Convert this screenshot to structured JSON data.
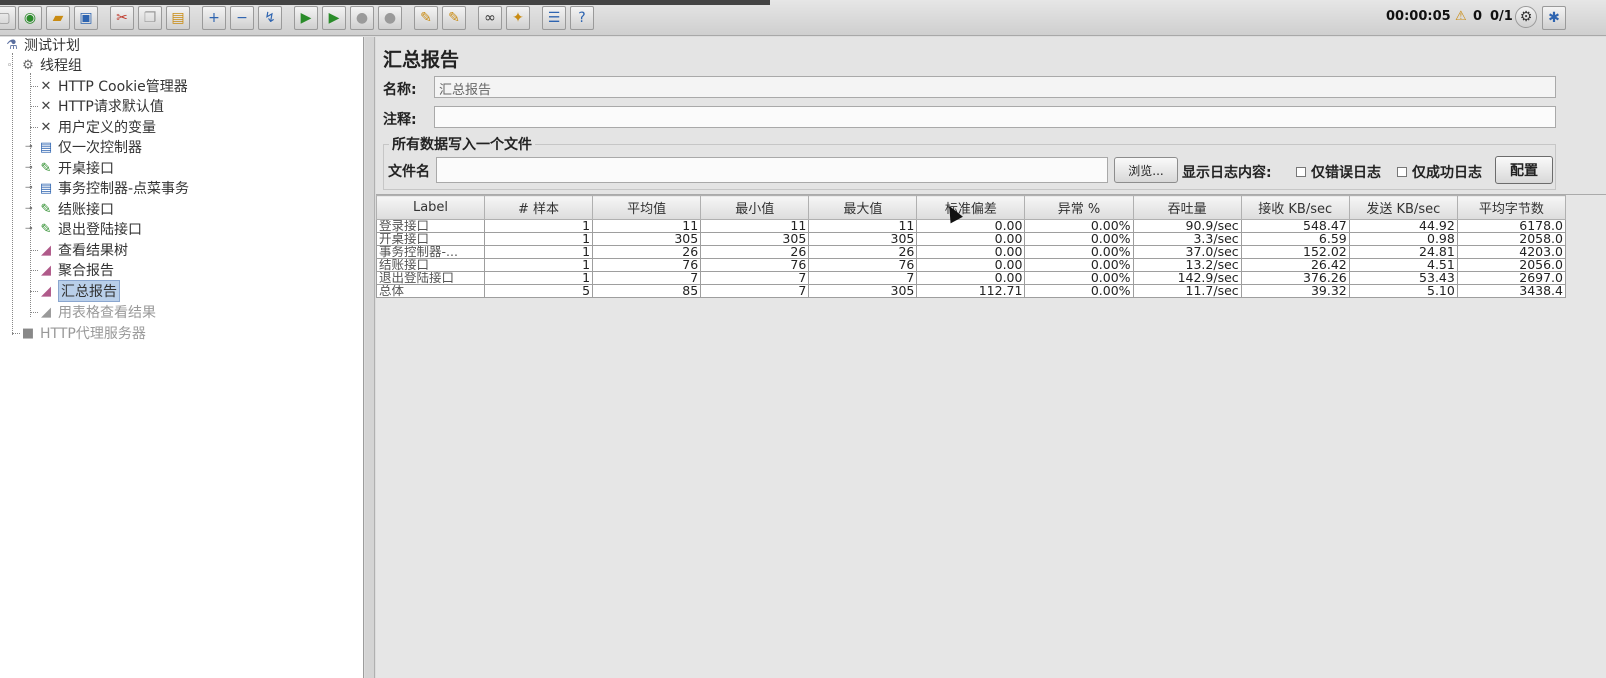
{
  "toolbar": {
    "timer": "00:00:05",
    "warnings": "0",
    "threads": "0/1",
    "icons": [
      "new-icon",
      "templates-icon",
      "open-icon",
      "save-icon",
      "cut-icon",
      "copy-icon",
      "paste-icon",
      "expand-icon",
      "collapse-icon",
      "toggle-icon",
      "start-icon",
      "start-no-pause-icon",
      "stop-icon",
      "shutdown-icon",
      "clear-icon",
      "clear-all-icon",
      "search-icon",
      "reset-search-icon",
      "function-helper-icon",
      "help-icon"
    ]
  },
  "tree": {
    "root": "测试计划",
    "thread_group": "线程组",
    "items": [
      {
        "label": "HTTP Cookie管理器",
        "icon": "wrench-icon"
      },
      {
        "label": "HTTP请求默认值",
        "icon": "wrench-icon"
      },
      {
        "label": "用户定义的变量",
        "icon": "wrench-icon"
      },
      {
        "label": "仅一次控制器",
        "icon": "controller-icon"
      },
      {
        "label": "开桌接口",
        "icon": "sampler-icon"
      },
      {
        "label": "事务控制器-点菜事务",
        "icon": "controller-icon"
      },
      {
        "label": "结账接口",
        "icon": "sampler-icon"
      },
      {
        "label": "退出登陆接口",
        "icon": "sampler-icon"
      },
      {
        "label": "查看结果树",
        "icon": "listener-icon"
      },
      {
        "label": "聚合报告",
        "icon": "listener-icon"
      },
      {
        "label": "汇总报告",
        "icon": "listener-icon"
      },
      {
        "label": "用表格查看结果",
        "icon": "listener-icon"
      }
    ],
    "proxy": "HTTP代理服务器"
  },
  "panel": {
    "title": "汇总报告",
    "name_label": "名称:",
    "name_value": "汇总报告",
    "comment_label": "注释:",
    "comment_value": "",
    "group_title": "所有数据写入一个文件",
    "filename_label": "文件名",
    "filename_value": "",
    "browse_button": "浏览...",
    "log_label": "显示日志内容:",
    "errors_only": "仅错误日志",
    "success_only": "仅成功日志",
    "configure_button": "配置"
  },
  "table": {
    "headers": [
      "Label",
      "# 样本",
      "平均值",
      "最小值",
      "最大值",
      "标准偏差",
      "异常 %",
      "吞吐量",
      "接收 KB/sec",
      "发送 KB/sec",
      "平均字节数"
    ],
    "rows": [
      [
        "登录接口",
        "1",
        "11",
        "11",
        "11",
        "0.00",
        "0.00%",
        "90.9/sec",
        "548.47",
        "44.92",
        "6178.0"
      ],
      [
        "开桌接口",
        "1",
        "305",
        "305",
        "305",
        "0.00",
        "0.00%",
        "3.3/sec",
        "6.59",
        "0.98",
        "2058.0"
      ],
      [
        "事务控制器-...",
        "1",
        "26",
        "26",
        "26",
        "0.00",
        "0.00%",
        "37.0/sec",
        "152.02",
        "24.81",
        "4203.0"
      ],
      [
        "结账接口",
        "1",
        "76",
        "76",
        "76",
        "0.00",
        "0.00%",
        "13.2/sec",
        "26.42",
        "4.51",
        "2056.0"
      ],
      [
        "退出登陆接口",
        "1",
        "7",
        "7",
        "7",
        "0.00",
        "0.00%",
        "142.9/sec",
        "376.26",
        "53.43",
        "2697.0"
      ],
      [
        "总体",
        "5",
        "85",
        "7",
        "305",
        "112.71",
        "0.00%",
        "11.7/sec",
        "39.32",
        "5.10",
        "3438.4"
      ]
    ]
  }
}
